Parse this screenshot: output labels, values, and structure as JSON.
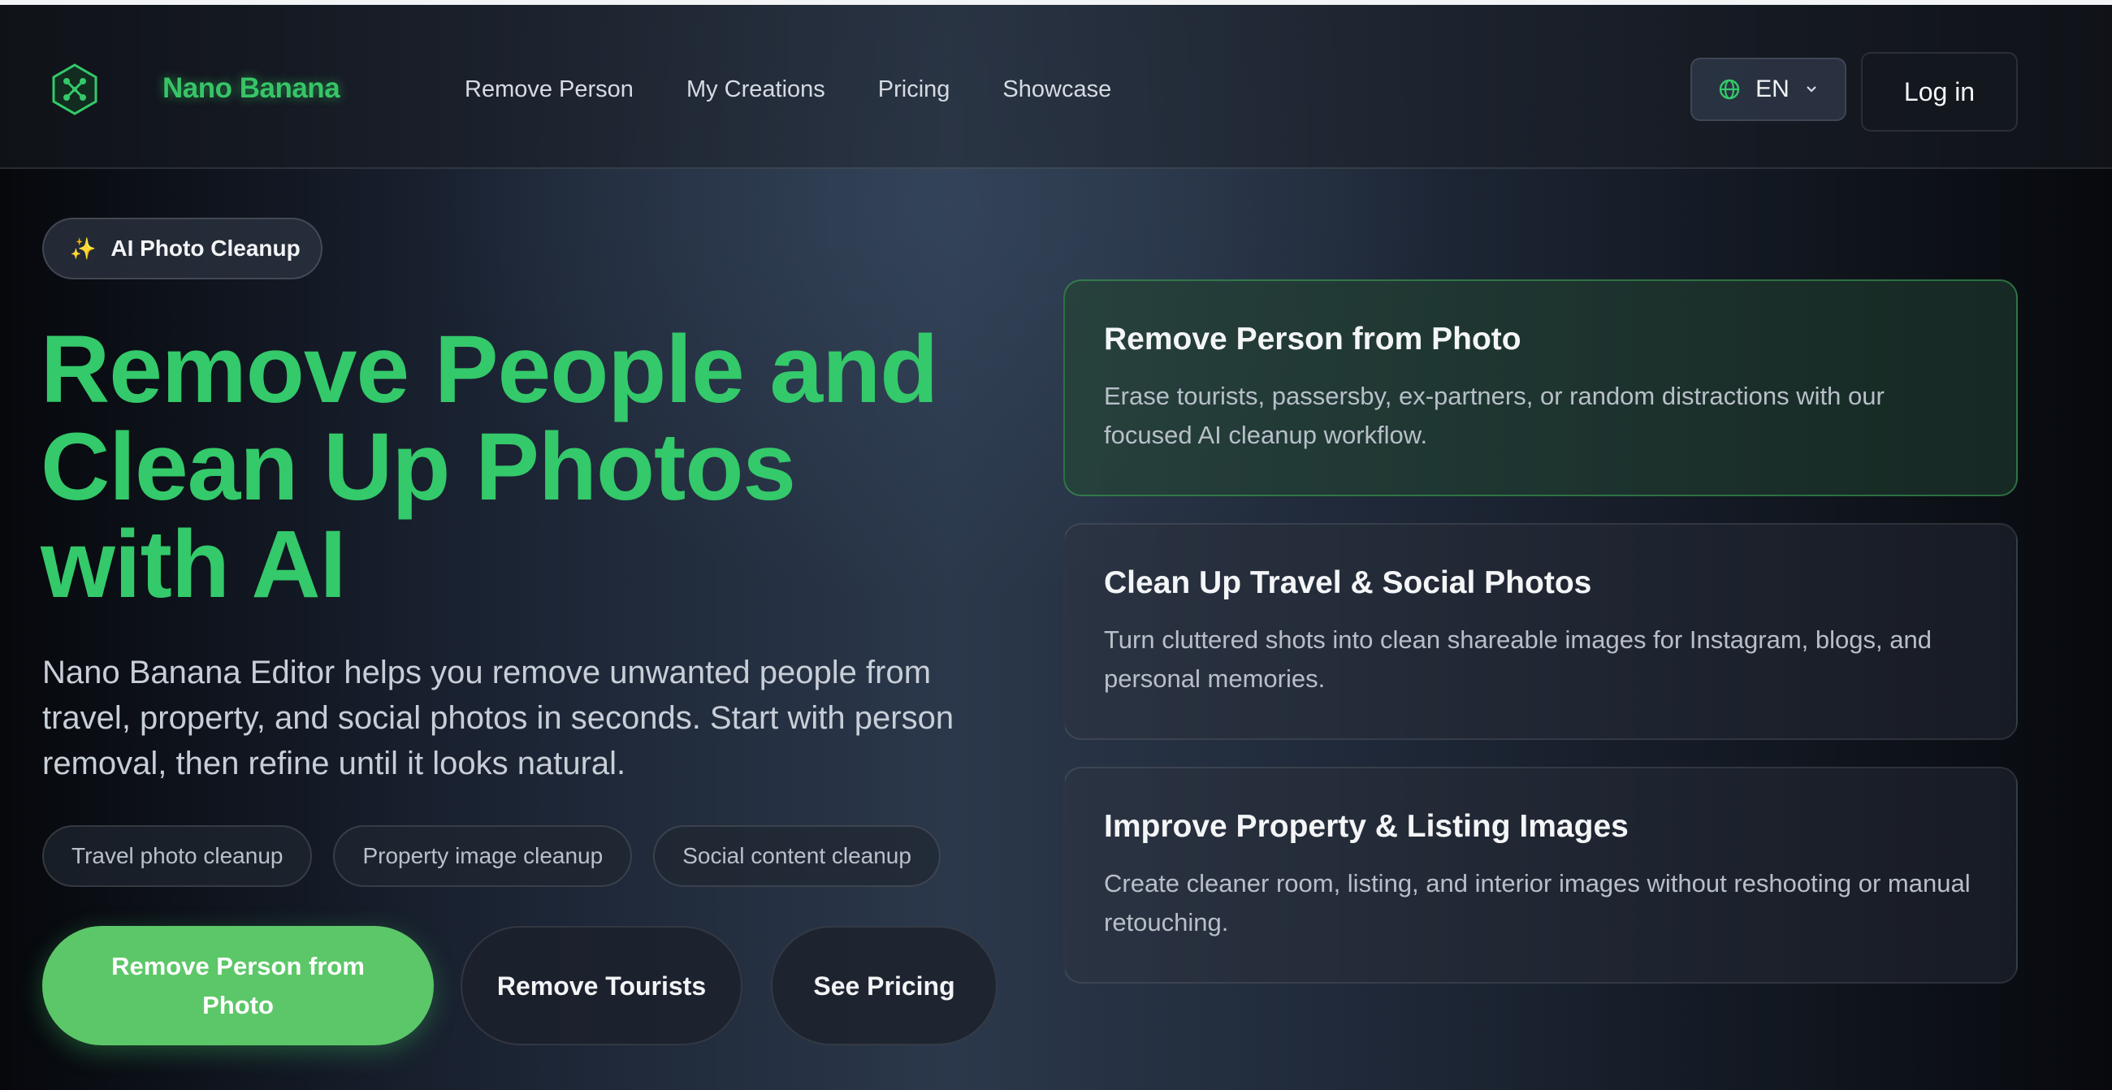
{
  "header": {
    "brand": "Nano Banana",
    "nav": [
      "Remove Person",
      "My Creations",
      "Pricing",
      "Showcase"
    ],
    "language": "EN",
    "login_label": "Log in"
  },
  "hero": {
    "badge": "AI Photo Cleanup",
    "headline_lines": [
      "Remove People and",
      "Clean Up Photos",
      "with AI"
    ],
    "subtext": "Nano Banana Editor helps you remove unwanted people from travel, property, and social photos in seconds. Start with person removal, then refine until it looks natural.",
    "tags": [
      "Travel photo cleanup",
      "Property image cleanup",
      "Social content cleanup"
    ],
    "cta_primary": "Remove Person from Photo",
    "cta_tourists": "Remove Tourists",
    "cta_pricing": "See Pricing"
  },
  "features": [
    {
      "title": "Remove Person from Photo",
      "description": "Erase tourists, passersby, ex-partners, or random distractions with our focused AI cleanup workflow."
    },
    {
      "title": "Clean Up Travel & Social Photos",
      "description": "Turn cluttered shots into clean shareable images for Instagram, blogs, and personal memories."
    },
    {
      "title": "Improve Property & Listing Images",
      "description": "Create cleaner room, listing, and interior images without reshooting or manual retouching."
    }
  ],
  "icons": {
    "logo": "hexagon-network-icon",
    "language": "globe-icon",
    "dropdown": "chevron-down-icon",
    "badge": "sparkles-icon"
  },
  "colors": {
    "accent": "#34c96a",
    "cta_primary": "#5cc768",
    "background": "#1a2231"
  }
}
